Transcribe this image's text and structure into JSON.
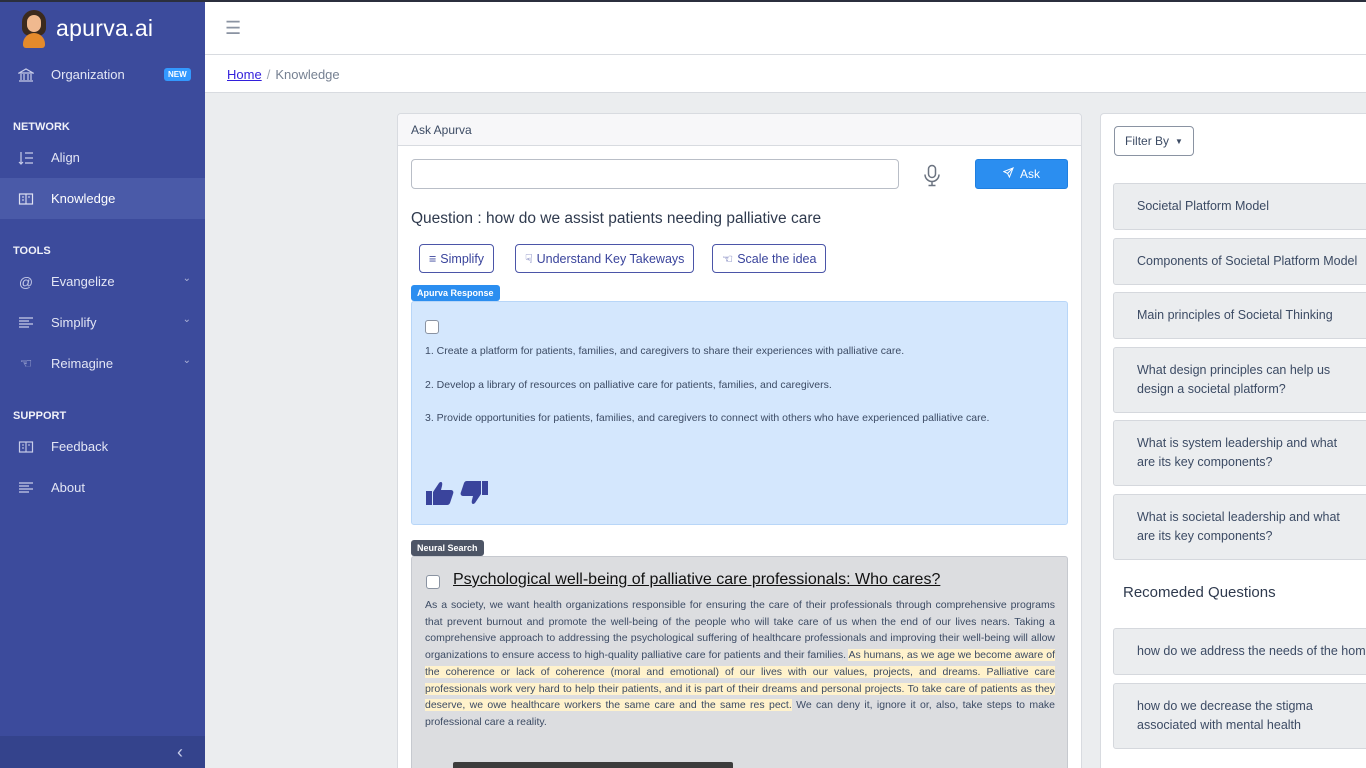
{
  "brand": {
    "name": "apurva.ai"
  },
  "sidebar": {
    "organization": {
      "label": "Organization",
      "badge": "NEW"
    },
    "sections": [
      {
        "title": "NETWORK",
        "items": [
          {
            "label": "Align"
          },
          {
            "label": "Knowledge"
          }
        ]
      },
      {
        "title": "TOOLS",
        "items": [
          {
            "label": "Evangelize"
          },
          {
            "label": "Simplify"
          },
          {
            "label": "Reimagine"
          }
        ]
      },
      {
        "title": "SUPPORT",
        "items": [
          {
            "label": "Feedback"
          },
          {
            "label": "About"
          }
        ]
      }
    ],
    "toggler": "‹"
  },
  "header": {
    "menu_icon": "☰"
  },
  "breadcrumb": {
    "home": "Home",
    "separator": "/",
    "current": "Knowledge"
  },
  "ask": {
    "card_title": "Ask Apurva",
    "input_value": "",
    "ask_label": "Ask",
    "question": "Question : how do we assist patients needing palliative care",
    "actions": [
      "Simplify",
      "Understand Key Takeways",
      "Scale the idea"
    ]
  },
  "response": {
    "tag": "Apurva Response",
    "lines": [
      "1. Create a platform for patients, families, and caregivers to share their experiences with palliative care.",
      "2. Develop a library of resources on palliative care for patients, families, and caregivers.",
      "3. Provide opportunities for patients, families, and caregivers to connect with others who have experienced palliative care."
    ]
  },
  "neural_search": {
    "tag": "Neural Search",
    "result_title": "Psychological well-being of palliative care professionals: Who cares?",
    "body_before": "As a society, we want health organizations responsible for ensuring the care of their professionals through comprehensive programs that prevent burnout and promote the well-being of the people who will take care of us when the end of our lives nears. Taking a comprehensive approach to addressing the psychological suffering of healthcare professionals and improving their well-being will allow organizations to ensure access to high-quality palliative care for patients and their families. ",
    "body_highlight": "As humans, as we age we become aware of the coherence or lack of coherence (moral and emotional) of our lives with our values, projects, and dreams. Palliative care professionals work very hard to help their patients, and it is part of their dreams and personal projects. To take care of patients as they deserve, we owe healthcare workers the same care and the same res pect.",
    "body_after": " We can deny it, ignore it or, also, take steps to make professional care a reality."
  },
  "right_panel": {
    "filter_label": "Filter By",
    "topics": [
      "Societal Platform Model",
      "Components of Societal Platform Model",
      "Main principles of Societal Thinking",
      "What design principles can help us design a societal platform?",
      "What is system leadership and what are its key components?",
      "What is societal leadership and what are its key components?"
    ],
    "recommended_title": "Recomeded Questions",
    "recommended": [
      "how do we address the needs of the homeless",
      "how do we decrease the stigma associated with mental health"
    ]
  },
  "colors": {
    "sidebar": "#3c4b9c",
    "primary": "#2b8ef0",
    "response_bg": "#d4e7fd",
    "highlight": "#fff2cc"
  }
}
